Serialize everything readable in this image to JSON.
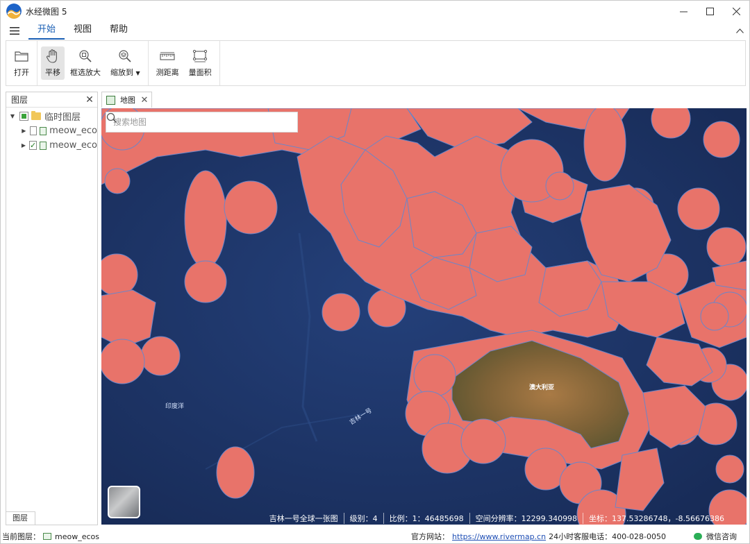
{
  "app": {
    "title": "水经微图 5"
  },
  "window": {
    "minimize_icon": "minimize-icon",
    "maximize_icon": "maximize-icon",
    "close_icon": "close-icon"
  },
  "menu": {
    "hamburger_icon": "hamburger-icon",
    "tabs": [
      {
        "label": "开始",
        "active": true
      },
      {
        "label": "视图",
        "active": false
      },
      {
        "label": "帮助",
        "active": false
      }
    ],
    "collapse_icon": "chevron-up-icon"
  },
  "ribbon": {
    "open": {
      "label": "打开",
      "icon": "folder-icon"
    },
    "pan": {
      "label": "平移",
      "icon": "hand-icon",
      "active": true
    },
    "box_zoom": {
      "label": "框选放大",
      "icon": "zoom-box-icon"
    },
    "zoom_to": {
      "label": "缩放到",
      "icon": "zoom-layers-icon"
    },
    "measure_distance": {
      "label": "测距离",
      "icon": "ruler-icon"
    },
    "measure_area": {
      "label": "量面积",
      "icon": "area-icon"
    }
  },
  "layers_panel": {
    "title": "图层",
    "tab_label": "图层",
    "tree": {
      "group_label": "临时图层",
      "layers": [
        {
          "label": "meow_eco",
          "checked": false
        },
        {
          "label": "meow_eco",
          "checked": true
        }
      ]
    }
  },
  "map_tab": {
    "label": "地图"
  },
  "map": {
    "search_placeholder": "搜索地图",
    "labels": {
      "ocean": "印度洋",
      "satellite": "吉林一号",
      "continent": "澳大利亚"
    },
    "status": {
      "basemap": "吉林一号全球一张图",
      "level": "级别：4",
      "scale": "比例：1：46485698",
      "resolution": "空间分辨率：12299.340998",
      "coordinates": "坐标：137.53286748，-8.56676386"
    },
    "colors": {
      "ocean": "#1f3566",
      "ecoregion_fill": "#e8736a",
      "ecoregion_stroke": "#6b86c9",
      "land": "#8a6a3d"
    }
  },
  "statusbar": {
    "current_layer_label": "当前图层：",
    "current_layer_value": "meow_ecos",
    "website_label": "官方网站：",
    "website_url": "https://www.rivermap.cn",
    "hotline": "24小时客服电话：400-028-0050",
    "wechat_label": "微信咨询"
  }
}
